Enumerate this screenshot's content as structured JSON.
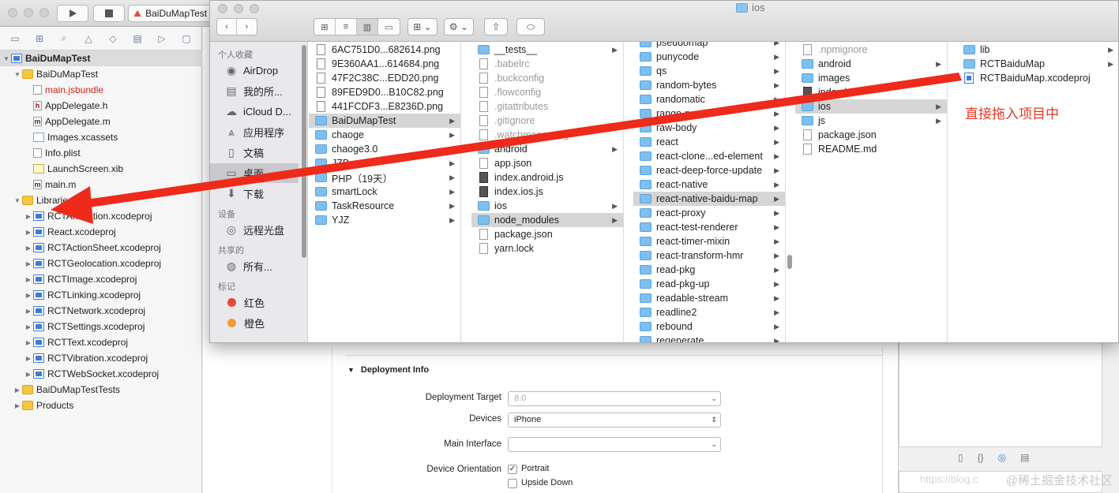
{
  "xcode": {
    "scheme_label": "BaiDuMapTest",
    "tree": [
      {
        "label": "BaiDuMapTest",
        "icon": "project-icon",
        "level": 0,
        "open": true,
        "sel": true,
        "bold": true
      },
      {
        "label": "BaiDuMapTest",
        "icon": "folder-icon",
        "level": 1,
        "open": true
      },
      {
        "label": "main.jsbundle",
        "icon": "file-icon",
        "level": 2,
        "red": true
      },
      {
        "label": "AppDelegate.h",
        "icon": "header-file-icon",
        "level": 2
      },
      {
        "label": "AppDelegate.m",
        "icon": "source-file-icon",
        "level": 2
      },
      {
        "label": "Images.xcassets",
        "icon": "assets-icon",
        "level": 2
      },
      {
        "label": "Info.plist",
        "icon": "file-icon",
        "level": 2
      },
      {
        "label": "LaunchScreen.xib",
        "icon": "xib-icon",
        "level": 2
      },
      {
        "label": "main.m",
        "icon": "source-file-icon",
        "level": 2
      },
      {
        "label": "Libraries",
        "icon": "folder-icon",
        "level": 1,
        "open": true
      },
      {
        "label": "RCTAnimation.xcodeproj",
        "icon": "xcodeproj-icon",
        "level": 2,
        "closed": true
      },
      {
        "label": "React.xcodeproj",
        "icon": "xcodeproj-icon",
        "level": 2,
        "closed": true
      },
      {
        "label": "RCTActionSheet.xcodeproj",
        "icon": "xcodeproj-icon",
        "level": 2,
        "closed": true
      },
      {
        "label": "RCTGeolocation.xcodeproj",
        "icon": "xcodeproj-icon",
        "level": 2,
        "closed": true
      },
      {
        "label": "RCTImage.xcodeproj",
        "icon": "xcodeproj-icon",
        "level": 2,
        "closed": true
      },
      {
        "label": "RCTLinking.xcodeproj",
        "icon": "xcodeproj-icon",
        "level": 2,
        "closed": true
      },
      {
        "label": "RCTNetwork.xcodeproj",
        "icon": "xcodeproj-icon",
        "level": 2,
        "closed": true
      },
      {
        "label": "RCTSettings.xcodeproj",
        "icon": "xcodeproj-icon",
        "level": 2,
        "closed": true
      },
      {
        "label": "RCTText.xcodeproj",
        "icon": "xcodeproj-icon",
        "level": 2,
        "closed": true
      },
      {
        "label": "RCTVibration.xcodeproj",
        "icon": "xcodeproj-icon",
        "level": 2,
        "closed": true
      },
      {
        "label": "RCTWebSocket.xcodeproj",
        "icon": "xcodeproj-icon",
        "level": 2,
        "closed": true
      },
      {
        "label": "BaiDuMapTestTests",
        "icon": "folder-icon",
        "level": 1,
        "closed": true
      },
      {
        "label": "Products",
        "icon": "folder-icon",
        "level": 1,
        "closed": true
      }
    ],
    "deployment": {
      "section_title": "Deployment Info",
      "target_label": "Deployment Target",
      "target_value": "8.0",
      "devices_label": "Devices",
      "devices_value": "iPhone",
      "main_interface_label": "Main Interface",
      "main_interface_value": "",
      "orientation_label": "Device Orientation",
      "portrait_label": "Portrait",
      "upside_down_label": "Upside Down"
    }
  },
  "finder": {
    "title": "ios",
    "sidebar": [
      {
        "type": "section",
        "label": "个人收藏"
      },
      {
        "type": "item",
        "label": "AirDrop",
        "icon": "airdrop-icon"
      },
      {
        "type": "item",
        "label": "我的所...",
        "icon": "all-files-icon"
      },
      {
        "type": "item",
        "label": "iCloud D...",
        "icon": "cloud-icon"
      },
      {
        "type": "item",
        "label": "应用程序",
        "icon": "applications-icon"
      },
      {
        "type": "item",
        "label": "文稿",
        "icon": "documents-icon"
      },
      {
        "type": "item",
        "label": "桌面",
        "icon": "desktop-icon",
        "sel": true
      },
      {
        "type": "item",
        "label": "下载",
        "icon": "downloads-icon"
      },
      {
        "type": "section",
        "label": "设备"
      },
      {
        "type": "item",
        "label": "远程光盘",
        "icon": "disc-icon"
      },
      {
        "type": "section",
        "label": "共享的"
      },
      {
        "type": "item",
        "label": "所有...",
        "icon": "network-icon"
      },
      {
        "type": "section",
        "label": "标记"
      },
      {
        "type": "tag",
        "label": "红色",
        "color": "#e8453c"
      },
      {
        "type": "tag",
        "label": "橙色",
        "color": "#f29b32"
      }
    ],
    "columns": [
      {
        "items": [
          {
            "label": "6AC751D0...682614.png",
            "kind": "img"
          },
          {
            "label": "9E360AA1...614684.png",
            "kind": "img"
          },
          {
            "label": "47F2C38C...EDD20.png",
            "kind": "img"
          },
          {
            "label": "89FED9D0...B10C82.png",
            "kind": "img"
          },
          {
            "label": "441FCDF3...E8236D.png",
            "kind": "img"
          },
          {
            "label": "BaiDuMapTest",
            "kind": "folder",
            "sel": true,
            "chev": true
          },
          {
            "label": "chaoge",
            "kind": "folder",
            "chev": true
          },
          {
            "label": "chaoge3.0",
            "kind": "folder",
            "chev": true
          },
          {
            "label": "JZB",
            "kind": "folder",
            "chev": true
          },
          {
            "label": "PHP（19天）",
            "kind": "folder",
            "chev": true
          },
          {
            "label": "smartLock",
            "kind": "folder",
            "chev": true
          },
          {
            "label": "TaskResource",
            "kind": "folder",
            "chev": true
          },
          {
            "label": "YJZ",
            "kind": "folder",
            "chev": true
          }
        ]
      },
      {
        "items": [
          {
            "label": "__tests__",
            "kind": "folder",
            "chev": true
          },
          {
            "label": ".babelrc",
            "kind": "file",
            "dim": true
          },
          {
            "label": ".buckconfig",
            "kind": "file",
            "dim": true
          },
          {
            "label": ".flowconfig",
            "kind": "file",
            "dim": true
          },
          {
            "label": ".gitattributes",
            "kind": "file",
            "dim": true
          },
          {
            "label": ".gitignore",
            "kind": "file",
            "dim": true
          },
          {
            "label": ".watchmanconfig",
            "kind": "file",
            "dim": true
          },
          {
            "label": "android",
            "kind": "folder",
            "chev": true
          },
          {
            "label": "app.json",
            "kind": "file"
          },
          {
            "label": "index.android.js",
            "kind": "file",
            "dark": true
          },
          {
            "label": "index.ios.js",
            "kind": "file",
            "dark": true
          },
          {
            "label": "ios",
            "kind": "folder",
            "chev": true
          },
          {
            "label": "node_modules",
            "kind": "folder",
            "sel": true,
            "chev": true
          },
          {
            "label": "package.json",
            "kind": "file"
          },
          {
            "label": "yarn.lock",
            "kind": "file"
          }
        ]
      },
      {
        "items": [
          {
            "label": "pseudomap",
            "kind": "folder",
            "chev": true
          },
          {
            "label": "punycode",
            "kind": "folder",
            "chev": true
          },
          {
            "label": "qs",
            "kind": "folder",
            "chev": true
          },
          {
            "label": "random-bytes",
            "kind": "folder",
            "chev": true
          },
          {
            "label": "randomatic",
            "kind": "folder",
            "chev": true
          },
          {
            "label": "range-parser",
            "kind": "folder",
            "chev": true
          },
          {
            "label": "raw-body",
            "kind": "folder",
            "chev": true
          },
          {
            "label": "react",
            "kind": "folder",
            "chev": true
          },
          {
            "label": "react-clone...ed-element",
            "kind": "folder",
            "chev": true
          },
          {
            "label": "react-deep-force-update",
            "kind": "folder",
            "chev": true
          },
          {
            "label": "react-native",
            "kind": "folder",
            "chev": true
          },
          {
            "label": "react-native-baidu-map",
            "kind": "folder",
            "sel": true,
            "chev": true
          },
          {
            "label": "react-proxy",
            "kind": "folder",
            "chev": true
          },
          {
            "label": "react-test-renderer",
            "kind": "folder",
            "chev": true
          },
          {
            "label": "react-timer-mixin",
            "kind": "folder",
            "chev": true
          },
          {
            "label": "react-transform-hmr",
            "kind": "folder",
            "chev": true
          },
          {
            "label": "read-pkg",
            "kind": "folder",
            "chev": true
          },
          {
            "label": "read-pkg-up",
            "kind": "folder",
            "chev": true
          },
          {
            "label": "readable-stream",
            "kind": "folder",
            "chev": true
          },
          {
            "label": "readline2",
            "kind": "folder",
            "chev": true
          },
          {
            "label": "rebound",
            "kind": "folder",
            "chev": true
          },
          {
            "label": "regenerate",
            "kind": "folder",
            "chev": true
          }
        ]
      },
      {
        "items": [
          {
            "label": ".npmignore",
            "kind": "file",
            "dim": true
          },
          {
            "label": "android",
            "kind": "folder",
            "chev": true
          },
          {
            "label": "images",
            "kind": "folder",
            "chev": true
          },
          {
            "label": "index.js",
            "kind": "file",
            "dark": true
          },
          {
            "label": "ios",
            "kind": "folder",
            "sel": true,
            "chev": true
          },
          {
            "label": "js",
            "kind": "folder",
            "chev": true
          },
          {
            "label": "package.json",
            "kind": "file"
          },
          {
            "label": "README.md",
            "kind": "file"
          }
        ]
      },
      {
        "items": [
          {
            "label": "lib",
            "kind": "folder",
            "chev": true
          },
          {
            "label": "RCTBaiduMap",
            "kind": "folder",
            "chev": true
          },
          {
            "label": "RCTBaiduMap.xcodeproj",
            "kind": "proj"
          }
        ]
      }
    ]
  },
  "annotation": "直接拖入项目中",
  "watermark": "@稀土掘金技术社区",
  "watermark_url": "https://blog.c",
  "colors": {
    "annotation": "#e23a24",
    "selection": "#d5d5d5",
    "folder": "#7dbff0"
  }
}
